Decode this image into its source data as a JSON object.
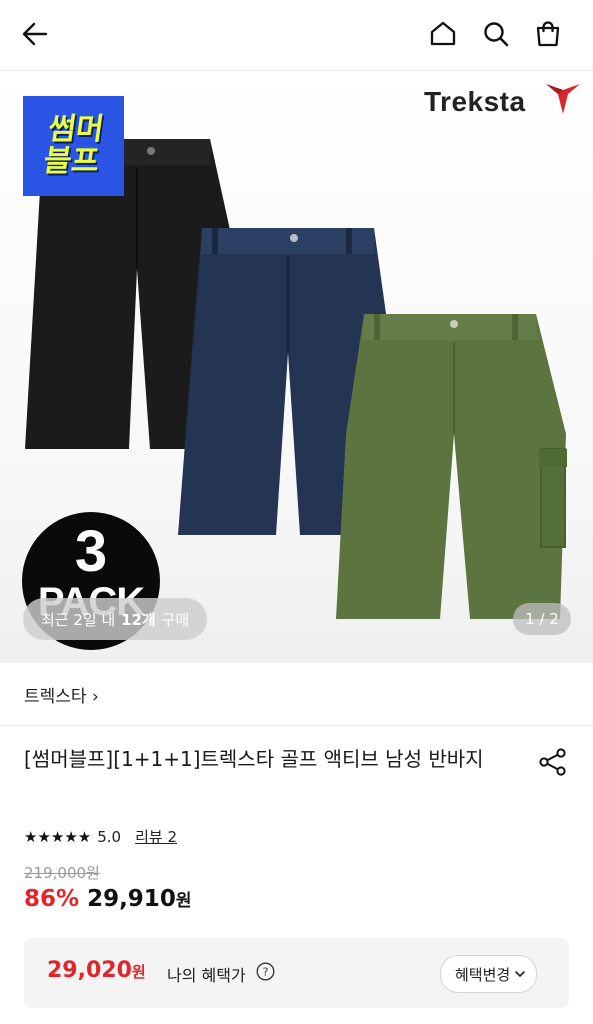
{
  "nav": {
    "back_icon": "arrow-left-icon",
    "home_icon": "home-icon",
    "search_icon": "search-icon",
    "cart_icon": "shopping-bag-icon"
  },
  "hero": {
    "promo_badge": "썸머\n블프",
    "brand_logo": "Treksta",
    "pack_number": "3",
    "pack_label": "PACK",
    "recent_prefix": "최근 2일 내 ",
    "recent_count": "12개",
    "recent_suffix": " 구매",
    "page_indicator": "1 / 2",
    "colors": {
      "promo_bg": "#2a55e4",
      "promo_text": "#e9ff3a",
      "black_short": "#1b1b1b",
      "navy_short": "#233552",
      "green_short": "#5c7440",
      "logo_red": "#d8262d"
    }
  },
  "brand": {
    "label": "트렉스타 ›"
  },
  "product": {
    "title": "[썸머블프][1+1+1]트렉스타 골프 액티브 남성 반바지",
    "stars": "★★★★★",
    "rating": "5.0",
    "review_link": "리뷰 2",
    "original_price": "219,000원",
    "discount": "86%",
    "sale_price": "29,910",
    "currency": "원"
  },
  "benefit": {
    "price": "29,020",
    "currency": "원",
    "label": "나의 혜택가",
    "button_label": "혜택변경",
    "button_icon": "chevron-down-icon"
  }
}
